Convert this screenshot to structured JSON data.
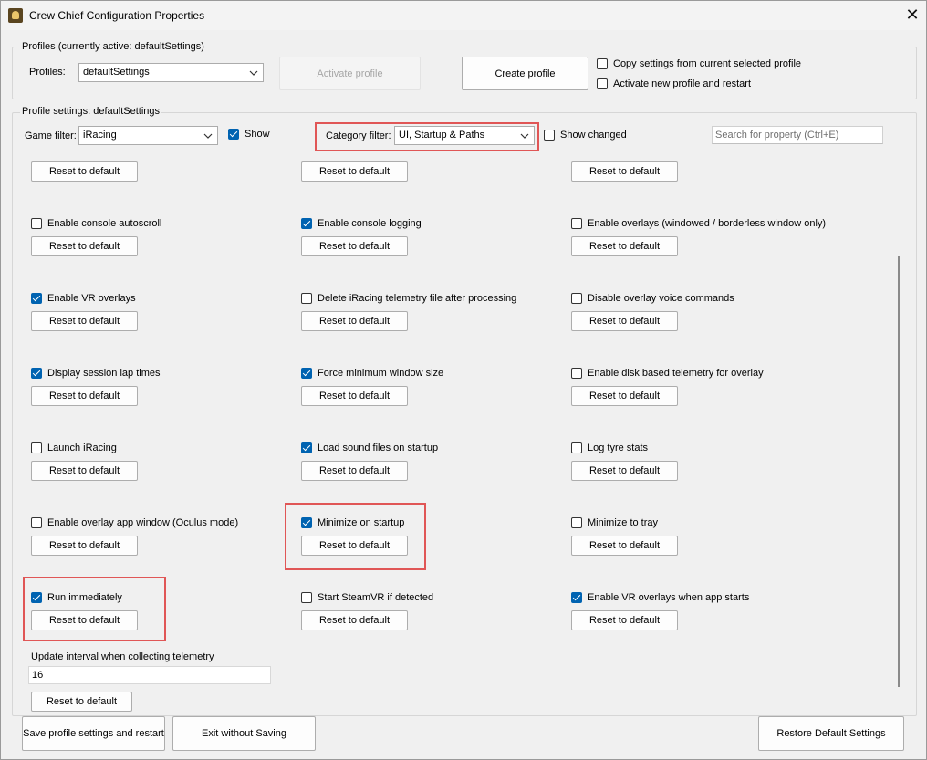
{
  "window": {
    "title": "Crew Chief Configuration Properties",
    "close_symbol": "✕"
  },
  "profiles": {
    "group_label": "Profiles (currently active: defaultSettings)",
    "label": "Profiles:",
    "selected": "defaultSettings",
    "activate_label": "Activate profile",
    "create_label": "Create profile",
    "copy_settings_label": "Copy settings from current selected profile",
    "copy_settings_checked": false,
    "activate_new_label": "Activate new profile and restart",
    "activate_new_checked": false
  },
  "profile_settings": {
    "group_label": "Profile settings: defaultSettings",
    "game_filter_label": "Game filter:",
    "game_filter_value": "iRacing",
    "show_label": "Show",
    "show_checked": true,
    "category_filter_label": "Category filter:",
    "category_filter_value": "UI, Startup & Paths",
    "show_changed_label": "Show changed",
    "show_changed_checked": false,
    "search_placeholder": "Search for property (Ctrl+E)"
  },
  "reset_label": "Reset to default",
  "settings": [
    {
      "label": "",
      "checked": false
    },
    {
      "label": "",
      "checked": false
    },
    {
      "label": "",
      "checked": false
    },
    {
      "label": "Enable console autoscroll",
      "checked": false
    },
    {
      "label": "Enable console logging",
      "checked": true
    },
    {
      "label": "Enable overlays (windowed / borderless window only)",
      "checked": false
    },
    {
      "label": "Enable VR overlays",
      "checked": true
    },
    {
      "label": "Delete iRacing telemetry file after processing",
      "checked": false
    },
    {
      "label": "Disable overlay voice commands",
      "checked": false
    },
    {
      "label": "Display session lap times",
      "checked": true
    },
    {
      "label": "Force minimum window size",
      "checked": true
    },
    {
      "label": "Enable disk based telemetry for overlay",
      "checked": false
    },
    {
      "label": "Launch iRacing",
      "checked": false
    },
    {
      "label": "Load sound files on startup",
      "checked": true
    },
    {
      "label": "Log tyre stats",
      "checked": false
    },
    {
      "label": "Enable overlay app window (Oculus mode)",
      "checked": false
    },
    {
      "label": "Minimize on startup",
      "checked": true
    },
    {
      "label": "Minimize to tray",
      "checked": false
    },
    {
      "label": "Run immediately",
      "checked": true
    },
    {
      "label": "Start SteamVR if detected",
      "checked": false
    },
    {
      "label": "Enable VR overlays when app starts",
      "checked": true
    }
  ],
  "update_interval": {
    "label": "Update interval when collecting telemetry",
    "value": "16",
    "reset_label": "Reset to default"
  },
  "footer": {
    "save_label": "Save profile settings and restart",
    "exit_label": "Exit without Saving",
    "restore_label": "Restore Default Settings"
  },
  "colors": {
    "accent": "#0063b1",
    "highlight": "#e05656",
    "background": "#f0f0f0"
  }
}
